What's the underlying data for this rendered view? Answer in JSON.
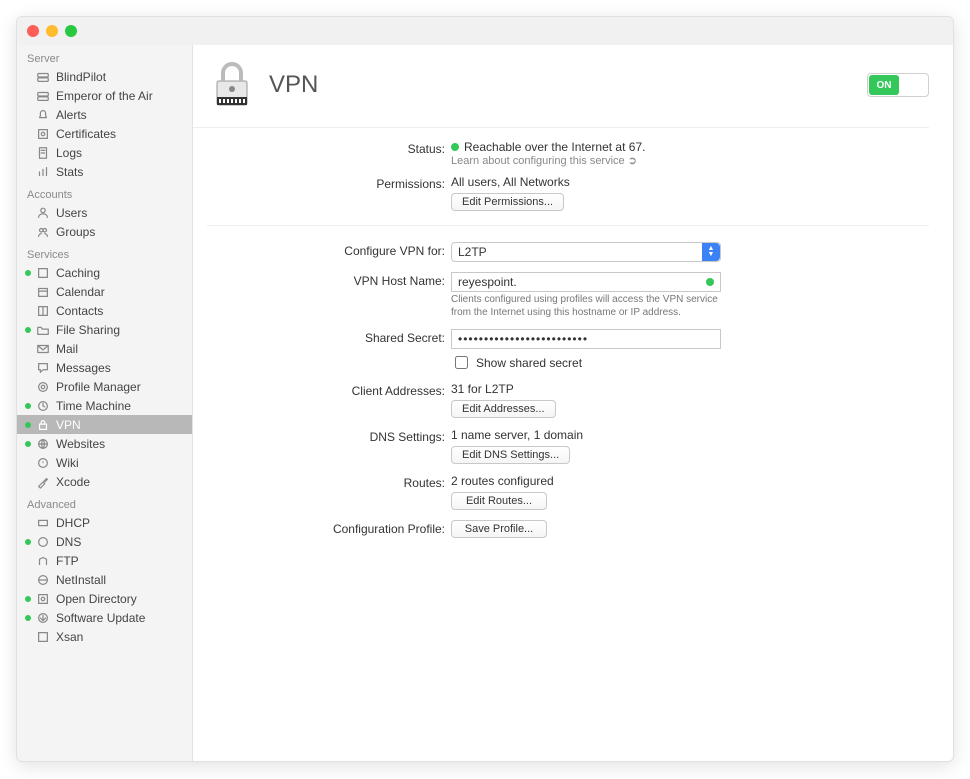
{
  "page_title": "VPN",
  "toggle": {
    "on_label": "ON"
  },
  "sidebar": {
    "groups": [
      {
        "label": "Server",
        "items": [
          {
            "name": "blindpilot",
            "label": "BlindPilot",
            "icon": "server",
            "dot": false
          },
          {
            "name": "emperor",
            "label": "Emperor of the Air",
            "icon": "server",
            "dot": false
          },
          {
            "name": "alerts",
            "label": "Alerts",
            "icon": "bell",
            "dot": false
          },
          {
            "name": "certificates",
            "label": "Certificates",
            "icon": "cert",
            "dot": false
          },
          {
            "name": "logs",
            "label": "Logs",
            "icon": "doc",
            "dot": false
          },
          {
            "name": "stats",
            "label": "Stats",
            "icon": "chart",
            "dot": false
          }
        ]
      },
      {
        "label": "Accounts",
        "items": [
          {
            "name": "users",
            "label": "Users",
            "icon": "user",
            "dot": false
          },
          {
            "name": "groups",
            "label": "Groups",
            "icon": "group",
            "dot": false
          }
        ]
      },
      {
        "label": "Services",
        "items": [
          {
            "name": "caching",
            "label": "Caching",
            "icon": "box",
            "dot": true
          },
          {
            "name": "calendar",
            "label": "Calendar",
            "icon": "cal",
            "dot": false
          },
          {
            "name": "contacts",
            "label": "Contacts",
            "icon": "book",
            "dot": false
          },
          {
            "name": "filesharing",
            "label": "File Sharing",
            "icon": "folder",
            "dot": true
          },
          {
            "name": "mail",
            "label": "Mail",
            "icon": "mail",
            "dot": false
          },
          {
            "name": "messages",
            "label": "Messages",
            "icon": "msg",
            "dot": false
          },
          {
            "name": "profilemgr",
            "label": "Profile Manager",
            "icon": "profile",
            "dot": false
          },
          {
            "name": "timemachine",
            "label": "Time Machine",
            "icon": "clock",
            "dot": true
          },
          {
            "name": "vpn",
            "label": "VPN",
            "icon": "lock",
            "dot": true,
            "selected": true
          },
          {
            "name": "websites",
            "label": "Websites",
            "icon": "globe",
            "dot": true
          },
          {
            "name": "wiki",
            "label": "Wiki",
            "icon": "wiki",
            "dot": false
          },
          {
            "name": "xcode",
            "label": "Xcode",
            "icon": "hammer",
            "dot": false
          }
        ]
      },
      {
        "label": "Advanced",
        "items": [
          {
            "name": "dhcp",
            "label": "DHCP",
            "icon": "dhcp",
            "dot": false
          },
          {
            "name": "dns",
            "label": "DNS",
            "icon": "dns",
            "dot": true
          },
          {
            "name": "ftp",
            "label": "FTP",
            "icon": "ftp",
            "dot": false
          },
          {
            "name": "netinstall",
            "label": "NetInstall",
            "icon": "net",
            "dot": false
          },
          {
            "name": "opendirectory",
            "label": "Open Directory",
            "icon": "od",
            "dot": true
          },
          {
            "name": "softwareupdate",
            "label": "Software Update",
            "icon": "su",
            "dot": true
          },
          {
            "name": "xsan",
            "label": "Xsan",
            "icon": "xsan",
            "dot": false
          }
        ]
      }
    ]
  },
  "form": {
    "status_label": "Status:",
    "status_value": "Reachable over the Internet at 67.",
    "status_learn": "Learn about configuring this service",
    "permissions_label": "Permissions:",
    "permissions_value": "All users, All Networks",
    "edit_permissions_btn": "Edit Permissions...",
    "configure_label": "Configure VPN for:",
    "configure_value": "L2TP",
    "hostname_label": "VPN Host Name:",
    "hostname_value": "reyespoint.",
    "hostname_hint": "Clients configured using profiles will access the VPN service from the Internet using this hostname or IP address.",
    "secret_label": "Shared Secret:",
    "secret_value": "•••••••••••••••••••••••••",
    "show_secret_label": "Show shared secret",
    "client_addr_label": "Client Addresses:",
    "client_addr_value": "31 for L2TP",
    "edit_addresses_btn": "Edit Addresses...",
    "dns_label": "DNS Settings:",
    "dns_value": "1 name server, 1 domain",
    "edit_dns_btn": "Edit DNS Settings...",
    "routes_label": "Routes:",
    "routes_value": "2 routes configured",
    "edit_routes_btn": "Edit Routes...",
    "profile_label": "Configuration Profile:",
    "save_profile_btn": "Save Profile..."
  }
}
